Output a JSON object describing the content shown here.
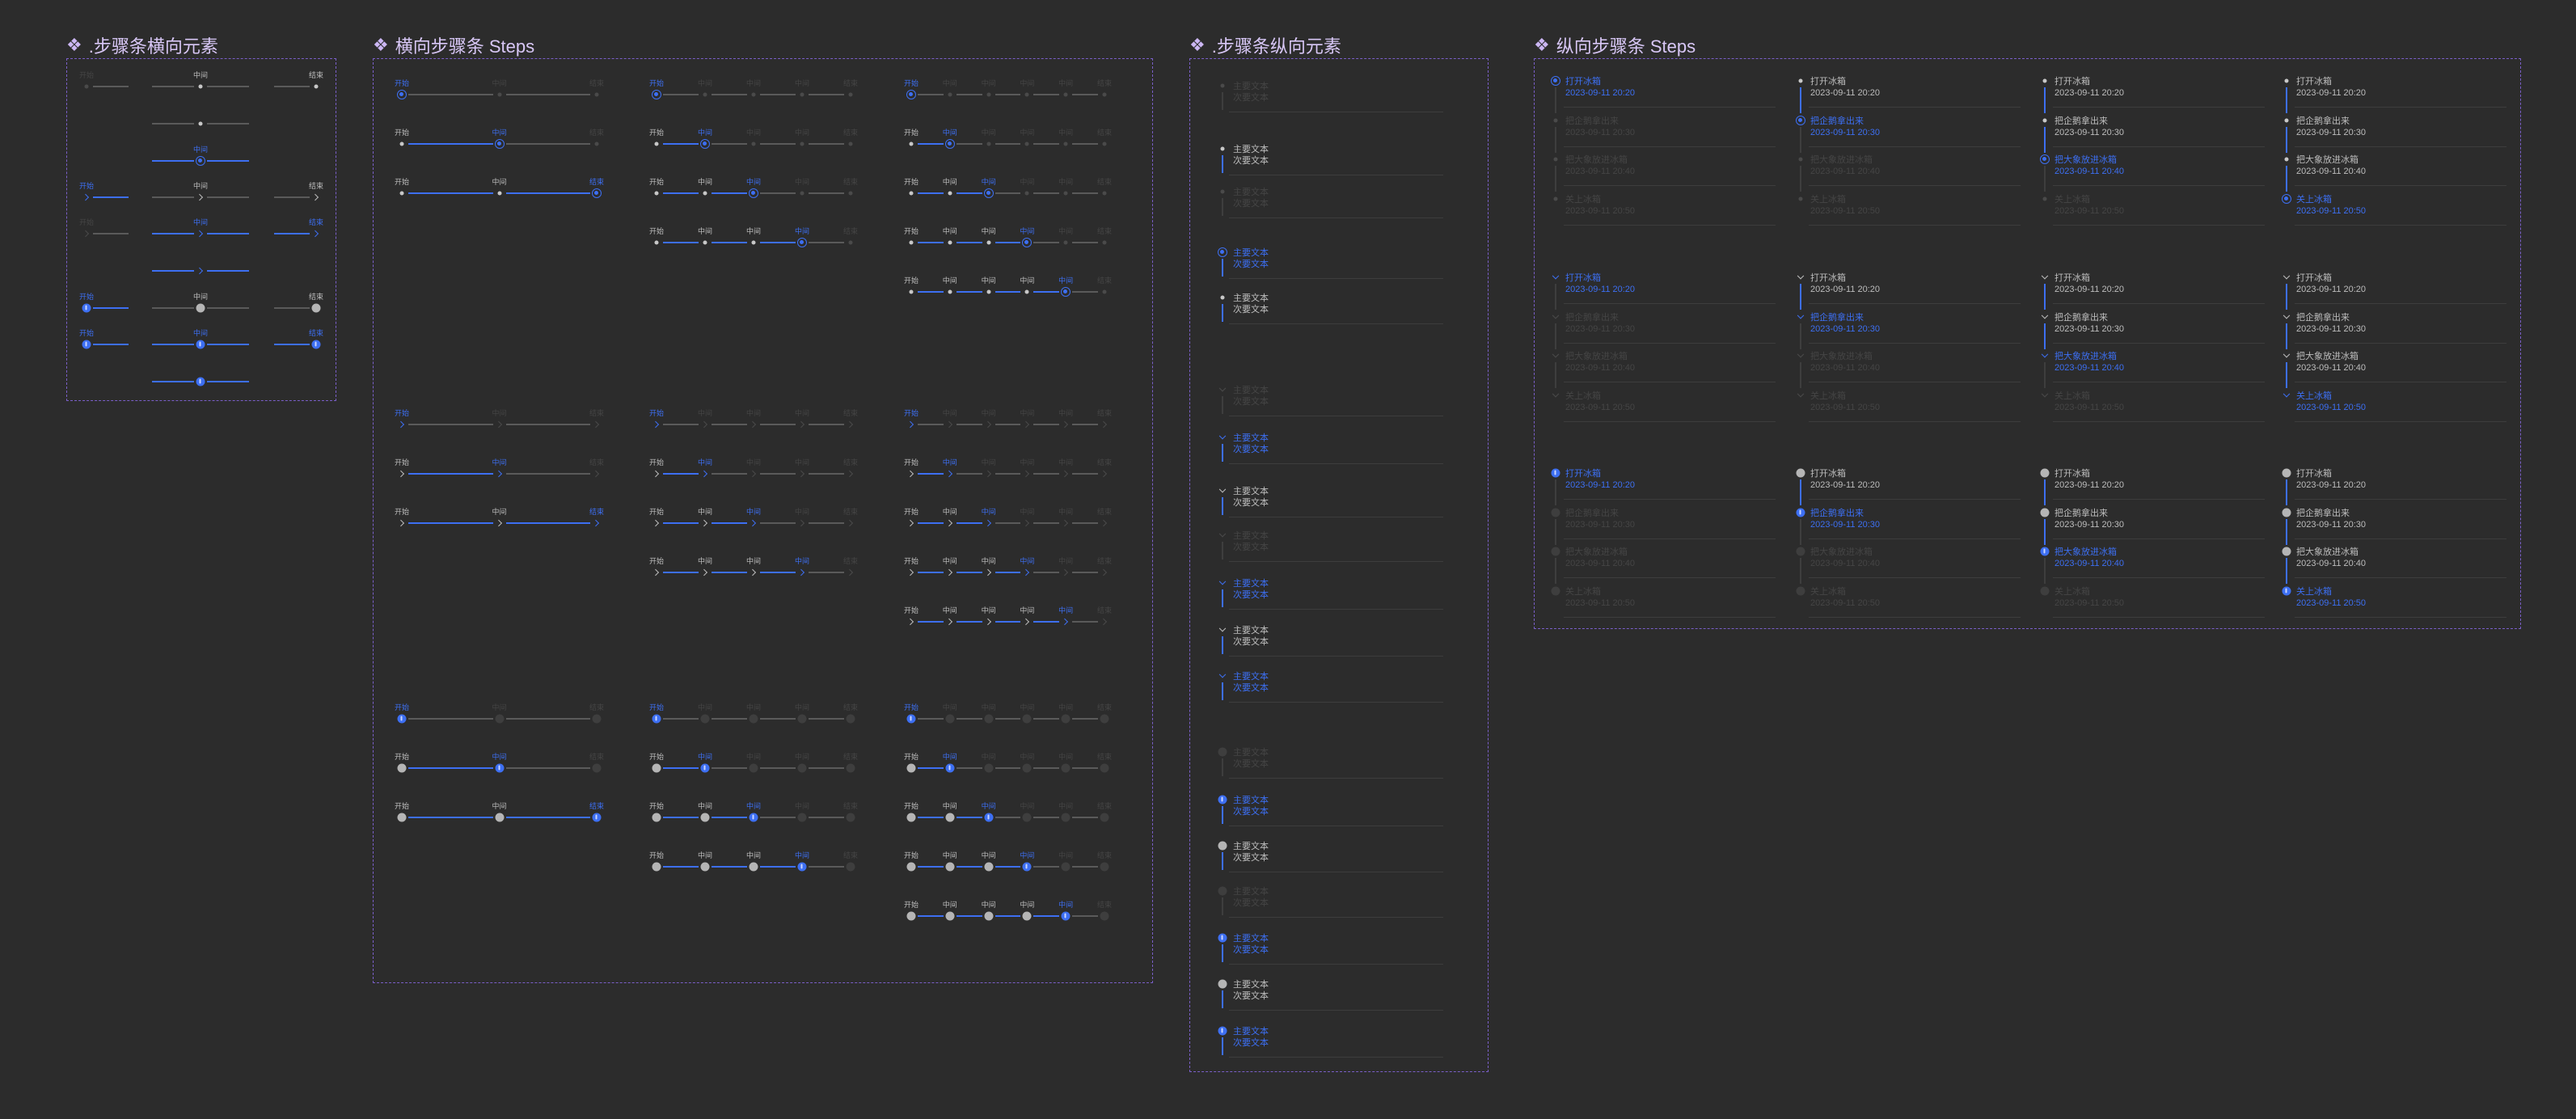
{
  "sections": [
    {
      "title": ".步骤条横向元素"
    },
    {
      "title": "横向步骤条 Steps"
    },
    {
      "title": ".步骤条纵向元素"
    },
    {
      "title": "纵向步骤条 Steps"
    }
  ],
  "step_labels": {
    "start": "开始",
    "middle": "中间",
    "end": "结束"
  },
  "vertical_element_text": {
    "primary": "主要文本",
    "secondary": "次要文本"
  },
  "vertical_steps": {
    "items": [
      {
        "title": "打开冰箱",
        "time": "2023-09-11 20:20"
      },
      {
        "title": "把企鹅拿出来",
        "time": "2023-09-11 20:30"
      },
      {
        "title": "把大象放进冰箱",
        "time": "2023-09-11 20:40"
      },
      {
        "title": "关上冰箱",
        "time": "2023-09-11 20:50"
      }
    ]
  },
  "colors": {
    "background": "#2c2c2c",
    "frame_border": "#7a5fc8",
    "title": "#d8c7f6",
    "active": "#3d6ff2",
    "done_text": "#bdbdbd",
    "pending": "#454545"
  },
  "icons": [
    "diamond-icon",
    "step-dot-icon",
    "step-ring-icon",
    "chevron-right-icon",
    "chevron-down-icon",
    "step-circle-icon"
  ]
}
